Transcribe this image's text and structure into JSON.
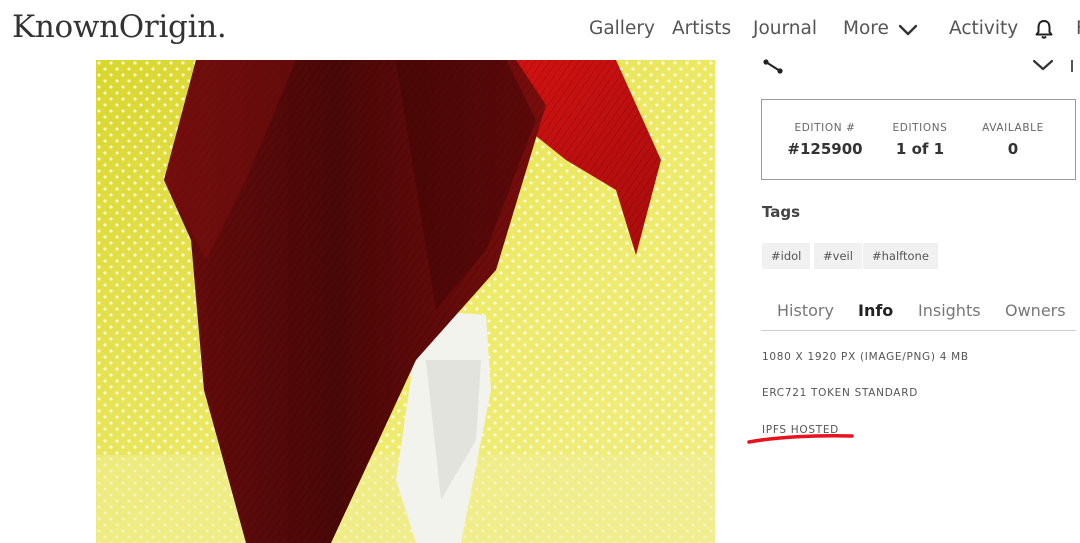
{
  "brand": {
    "logo": "KnownOrigin."
  },
  "nav": {
    "gallery": "Gallery",
    "artists": "Artists",
    "journal": "Journal",
    "more": "More",
    "activity": "Activity",
    "cut_off": "F"
  },
  "stats": {
    "edition_label": "EDITION #",
    "edition_value": "#125900",
    "editions_label": "EDITIONS",
    "editions_value": "1 of 1",
    "available_label": "AVAILABLE",
    "available_value": "0"
  },
  "tags": {
    "title": "Tags",
    "items": [
      "#idol",
      "#veil",
      "#halftone"
    ]
  },
  "tabs": {
    "items": [
      "History",
      "Info",
      "Insights",
      "Owners"
    ],
    "active": "Info"
  },
  "info": {
    "dimensions": "1080 X 1920 PX (IMAGE/PNG) 4 MB",
    "standard": "ERC721 TOKEN STANDARD",
    "hosting": "IPFS HOSTED"
  },
  "icons": {
    "notifications": "bell-icon",
    "more": "chevron-down-icon",
    "share": "share-icon",
    "collapse": "chevron-down-icon"
  },
  "colors": {
    "artwork_background": "#e6e24a",
    "veil_dark": "#5e0a0a",
    "veil_bright": "#c80f0f",
    "annotation": "#e8121f"
  }
}
